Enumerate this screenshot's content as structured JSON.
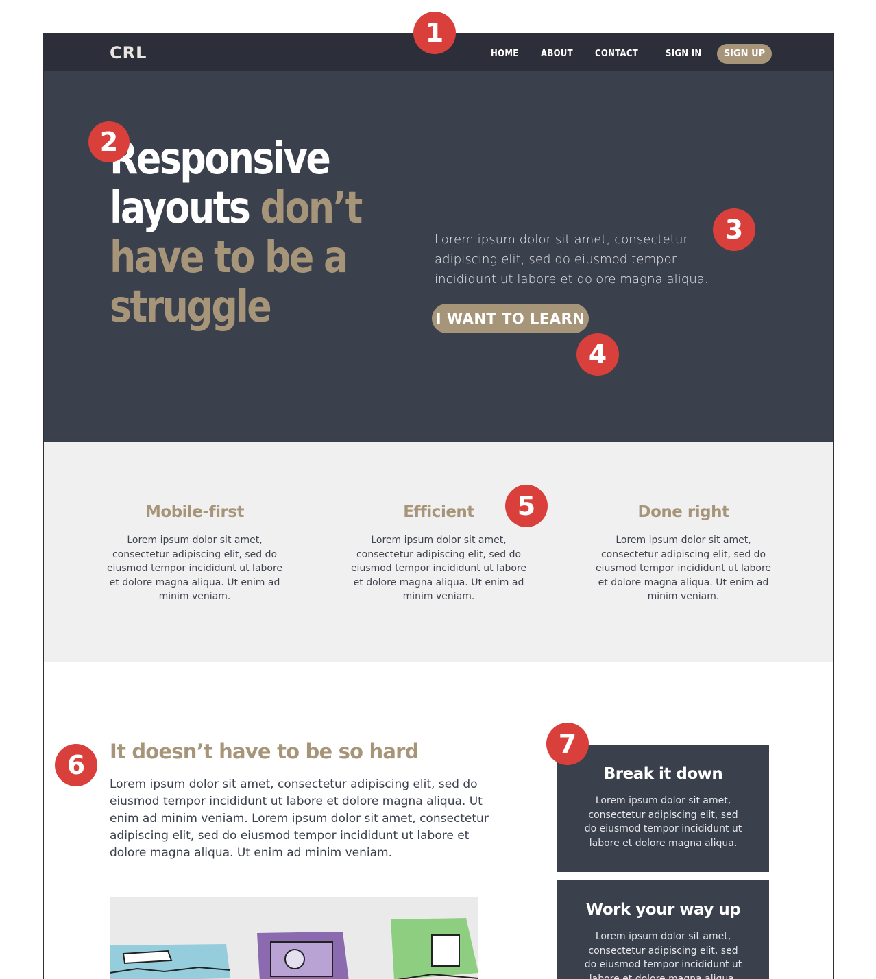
{
  "nav": {
    "logo": "CRL",
    "links": [
      "HOME",
      "ABOUT",
      "CONTACT",
      "SIGN IN"
    ],
    "signup": "SIGN UP"
  },
  "hero": {
    "title_white_1": "Responsive",
    "title_white_2": "layouts",
    "title_accent_1": "don’t",
    "title_accent_2": "have to be a",
    "title_accent_3": "struggle",
    "text": "Lorem ipsum dolor sit amet, consectetur adipiscing elit, sed do eiusmod tempor incididunt ut labore et dolore magna aliqua.",
    "button": "I WANT TO LEARN"
  },
  "features": [
    {
      "title": "Mobile-first",
      "text": "Lorem ipsum dolor sit amet, consectetur adipiscing elit, sed do eiusmod tempor incididunt ut labore et dolore magna aliqua. Ut enim ad minim veniam."
    },
    {
      "title": "Efficient",
      "text": "Lorem ipsum dolor sit amet, consectetur adipiscing elit, sed do eiusmod tempor incididunt ut labore et dolore magna aliqua. Ut enim ad minim veniam."
    },
    {
      "title": "Done right",
      "text": "Lorem ipsum dolor sit amet, consectetur adipiscing elit, sed do eiusmod tempor incididunt ut labore et dolore magna aliqua. Ut enim ad minim veniam."
    }
  ],
  "content": {
    "title": "It doesn’t have to be so hard",
    "text": "Lorem ipsum dolor sit amet, consectetur adipiscing elit, sed do eiusmod tempor incididunt ut labore et dolore magna aliqua. Ut enim ad minim veniam. Lorem ipsum dolor sit amet, consectetur adipiscing elit, sed do eiusmod tempor incididunt ut labore et dolore magna aliqua. Ut enim ad minim veniam."
  },
  "cards": [
    {
      "title": "Break it down",
      "text": "Lorem ipsum dolor sit amet, consectetur adipiscing elit, sed do eiusmod tempor incididunt ut labore et dolore magna aliqua."
    },
    {
      "title": "Work your way up",
      "text": "Lorem ipsum dolor sit amet, consectetur adipiscing elit, sed do eiusmod tempor incididunt ut labore et dolore magna aliqua."
    }
  ],
  "markers": [
    "1",
    "2",
    "3",
    "4",
    "5",
    "6",
    "7"
  ],
  "colors": {
    "nav_bg": "#2c2f3a",
    "hero_bg": "#3b404d",
    "accent": "#a7957a",
    "features_bg": "#f0f0f0",
    "marker": "#d9403b"
  }
}
